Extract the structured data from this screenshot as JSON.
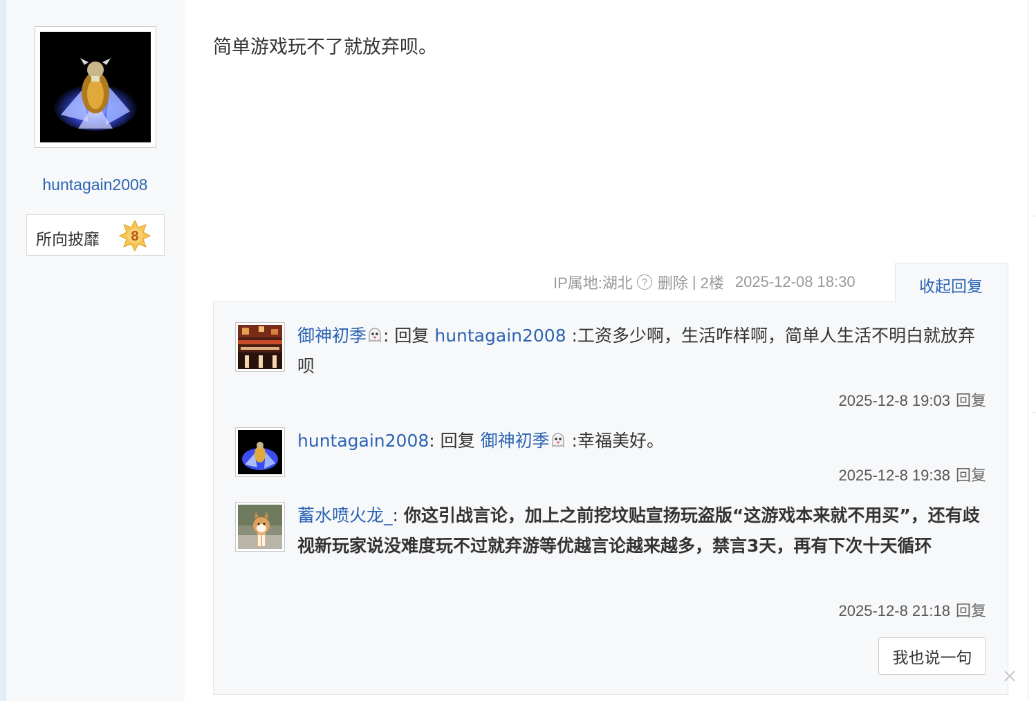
{
  "post": {
    "author": {
      "name": "huntagain2008",
      "badge_title": "所向披靡",
      "badge_level": "8"
    },
    "content": "简单游戏玩不了就放弃呗。",
    "tail": {
      "ip_label": "IP属地:湖北",
      "help_icon": "?",
      "delete_label": "删除",
      "separator": "|",
      "floor": "2楼",
      "datetime": "2025-12-08 18:30"
    },
    "collapse_label": "收起回复"
  },
  "replies": [
    {
      "user": "御神初季",
      "after_user": ": 回复 ",
      "target": "huntagain2008",
      "text": " :工资多少啊，生活咋样啊，简单人生活不明白就放弃呗",
      "time": "2025-12-8 19:03",
      "reply_label": "回复"
    },
    {
      "user": "huntagain2008",
      "after_user": ": 回复 ",
      "target": "御神初季",
      "text": " :幸福美好。",
      "time": "2025-12-8 19:38",
      "reply_label": "回复"
    },
    {
      "user": "蓄水喷火龙_",
      "after_user": ": ",
      "text": "你这引战言论，加上之前挖坟贴宣扬玩盗版“这游戏本来就不用买”，还有歧视新玩家说没难度玩不过就弃游等优越言论越来越多，禁言3天，再有下次十天循环",
      "time": "2025-12-8 21:18",
      "reply_label": "回复"
    }
  ],
  "say_button": "我也说一句",
  "icons": {
    "help": "question-circle-icon",
    "ghost": "ghost-emoji-icon",
    "level": "star-badge-icon",
    "close": "close-icon"
  },
  "colors": {
    "link": "#2d64b3",
    "meta": "#999999",
    "panel": "#f7f8fa"
  }
}
